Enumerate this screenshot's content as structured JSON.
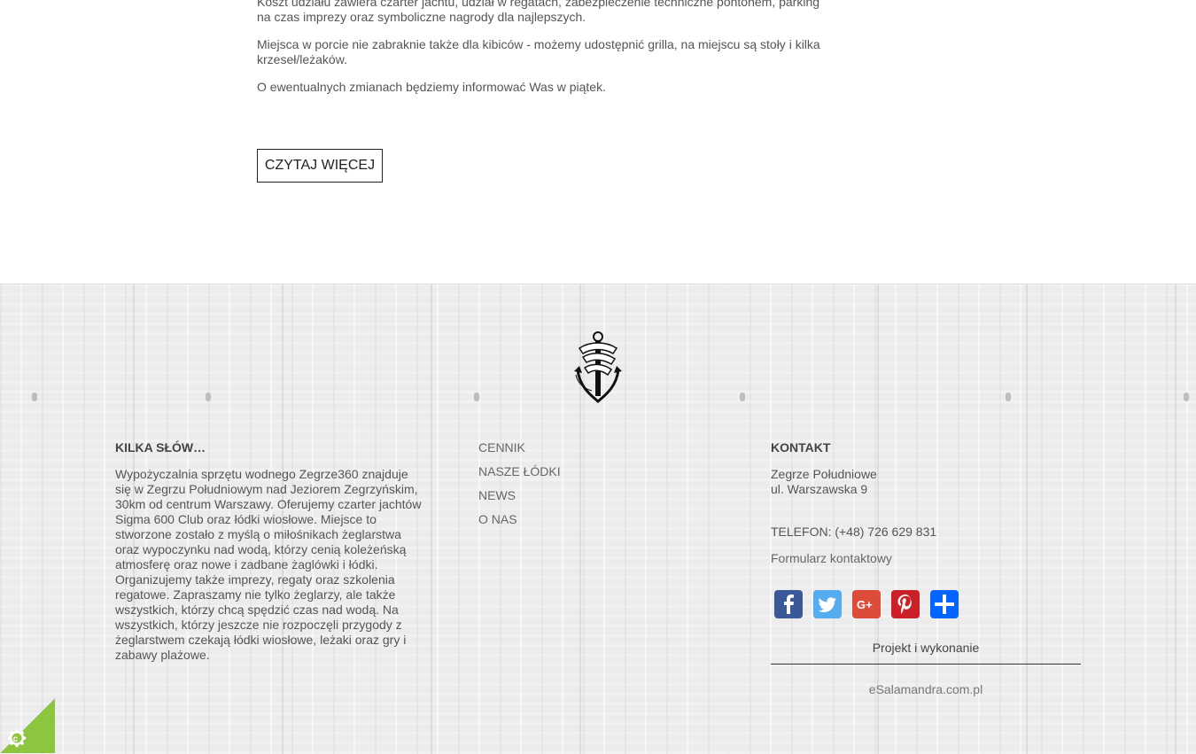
{
  "article": {
    "paragraph_1_line_1": "Koszt udziału zawiera czarter jachtu, udział w regatach, zabezpieczenie techniczne pontonem, parking",
    "paragraph_1_line_2": "na czas imprezy oraz symboliczne nagrody dla najlepszych.",
    "paragraph_2_line_1": "Miejsca w porcie nie zabraknie także dla kibiców - możemy udostępnić grilla, na miejscu są stoły i kilka",
    "paragraph_2_line_2": "krzeseł/leżaków.",
    "paragraph_3": "O ewentualnych zmianach będziemy informować Was w piątek.",
    "read_more_label": "CZYTAJ WIĘCEJ"
  },
  "footer": {
    "logo_icon": "anchor-icon",
    "about": {
      "title": "KILKA SŁÓW…",
      "lines": [
        "Wypożyczalnia sprzętu wodnego Zegrze360 znajduje",
        "się w Zegrzu Południowym nad Jeziorem Zegrzyńskim,",
        "30km od centrum Warszawy. Oferujemy czarter jachtów",
        "Sigma 600 Club oraz łódki wiosłowe. Miejsce to",
        "stworzone zostało z myślą o miłośnikach żeglarstwa",
        "oraz wypoczynku nad wodą, którzy cenią koleżeńską",
        "atmosferę oraz nowe i zadbane żaglówki i łódki.",
        "Organizujemy także imprezy, regaty oraz szkolenia",
        "regatowe. Zapraszamy nie tylko żeglarzy, ale także",
        "wszystkich, którzy chcą spędzić czas nad wodą. Na",
        "wszystkich, którzy jeszcze nie rozpoczęli przygody z",
        "żeglarstwem czekają łódki wiosłowe, leżaki oraz gry i",
        "zabawy plażowe."
      ]
    },
    "nav": {
      "items": [
        {
          "label": "CENNIK"
        },
        {
          "label": "NASZE ŁÓDKI"
        },
        {
          "label": "NEWS"
        },
        {
          "label": "O NAS"
        }
      ]
    },
    "contact": {
      "title": "KONTAKT",
      "address_line_1": "Zegrze Południowe",
      "address_line_2": "ul. Warszawska 9",
      "phone": "TELEFON: (+48) 726 629 831",
      "form_link": "Formularz kontaktowy",
      "social": [
        {
          "icon": "facebook-icon",
          "color": "#3b5998"
        },
        {
          "icon": "twitter-icon",
          "color": "#55acee"
        },
        {
          "icon": "google-plus-icon",
          "color": "#dd4b39"
        },
        {
          "icon": "pinterest-icon",
          "color": "#cb2027"
        },
        {
          "icon": "share-icon",
          "color": "#0166ff"
        }
      ],
      "credits_title": "Projekt i wykonanie",
      "credits_link": "eSalamandra.com.pl"
    }
  },
  "cookie": {
    "icon": "cookie-settings-icon",
    "color": "#8cc63f"
  }
}
